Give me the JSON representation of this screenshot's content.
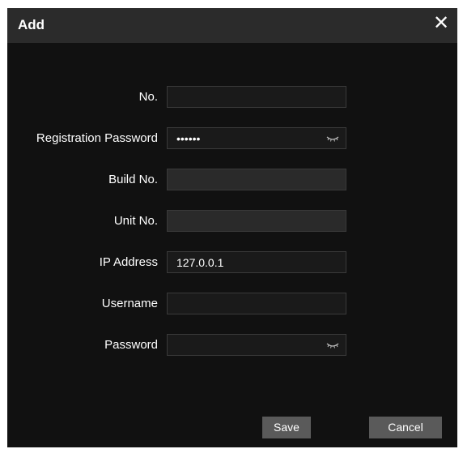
{
  "dialog": {
    "title": "Add",
    "close_glyph": "✕"
  },
  "form": {
    "no": {
      "label": "No.",
      "value": ""
    },
    "registration_password": {
      "label": "Registration Password",
      "value": "••••••"
    },
    "build_no": {
      "label": "Build No.",
      "value": ""
    },
    "unit_no": {
      "label": "Unit No.",
      "value": ""
    },
    "ip_address": {
      "label": "IP Address",
      "value": "127.0.0.1"
    },
    "username": {
      "label": "Username",
      "value": ""
    },
    "password": {
      "label": "Password",
      "value": ""
    }
  },
  "buttons": {
    "save_label": "Save",
    "cancel_label": "Cancel"
  },
  "icons": {
    "close": "close-icon",
    "eye": "eye-closed-icon"
  }
}
